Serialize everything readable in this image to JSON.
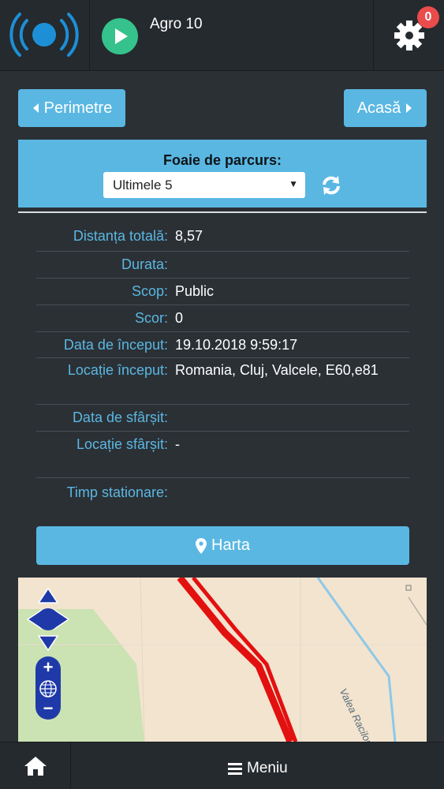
{
  "header": {
    "device_name": "Agro 10",
    "notification_count": "0",
    "logo_icon": "signal-broadcast-icon",
    "play_icon": "play-icon",
    "settings_icon": "gear-icon"
  },
  "nav": {
    "back_label": "Perimetre",
    "home_label": "Acasă"
  },
  "trip_panel": {
    "title": "Foaie de parcurs:",
    "select_value": "Ultimele 5",
    "refresh_icon": "refresh-icon"
  },
  "details": [
    {
      "label": "Distanța totală:",
      "value": "8,57"
    },
    {
      "label": "Durata:",
      "value": ""
    },
    {
      "label": "Scop:",
      "value": "Public"
    },
    {
      "label": "Scor:",
      "value": "0"
    },
    {
      "label": "Data de început:",
      "value": "19.10.2018 9:59:17"
    },
    {
      "label": "Locație început:",
      "value": "Romania, Cluj, Valcele, E60,e81"
    },
    {
      "label": "Data de sfârșit:",
      "value": ""
    },
    {
      "label": "Locație sfârșit:",
      "value": "-"
    },
    {
      "label": "Timp stationare:",
      "value": ""
    }
  ],
  "map_button": {
    "label": "Harta",
    "icon": "map-marker-icon"
  },
  "map": {
    "river_label": "Valea Racilor"
  },
  "footer": {
    "home_icon": "home-icon",
    "menu_label": "Meniu",
    "menu_icon": "hamburger-icon"
  },
  "colors": {
    "accent": "#5ab7e2",
    "play": "#35c28c",
    "badge": "#ea4b4b",
    "route": "#e31010",
    "background": "#2b3035"
  }
}
